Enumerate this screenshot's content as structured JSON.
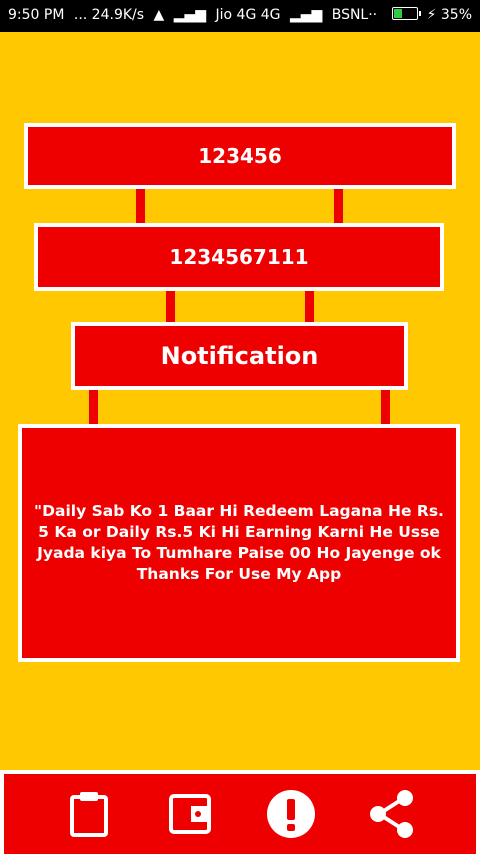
{
  "status_bar": {
    "time": "9:50 PM",
    "speed": "... 24.9K/s",
    "carrier1": "Jio 4G 4G",
    "carrier2": "BSNL··",
    "battery": "35%",
    "battery_level": 0.35
  },
  "boxes": {
    "box1_text": "123456",
    "box2_text": "1234567111",
    "box3_text": "Notification",
    "message": "\"Daily Sab Ko 1 Baar Hi Redeem Lagana He Rs. 5 Ka or Daily Rs.5 Ki Hi Earning Karni He Usse Jyada kiya To Tumhare Paise 00 Ho Jayenge ok Thanks For Use My App"
  },
  "bottom_nav": {
    "items": [
      {
        "icon": "clipboard-icon"
      },
      {
        "icon": "wallet-icon"
      },
      {
        "icon": "alert-icon"
      },
      {
        "icon": "share-icon"
      }
    ]
  },
  "colors": {
    "background": "#FFC800",
    "accent_red": "#EE0000",
    "border": "#FFFFFF"
  }
}
